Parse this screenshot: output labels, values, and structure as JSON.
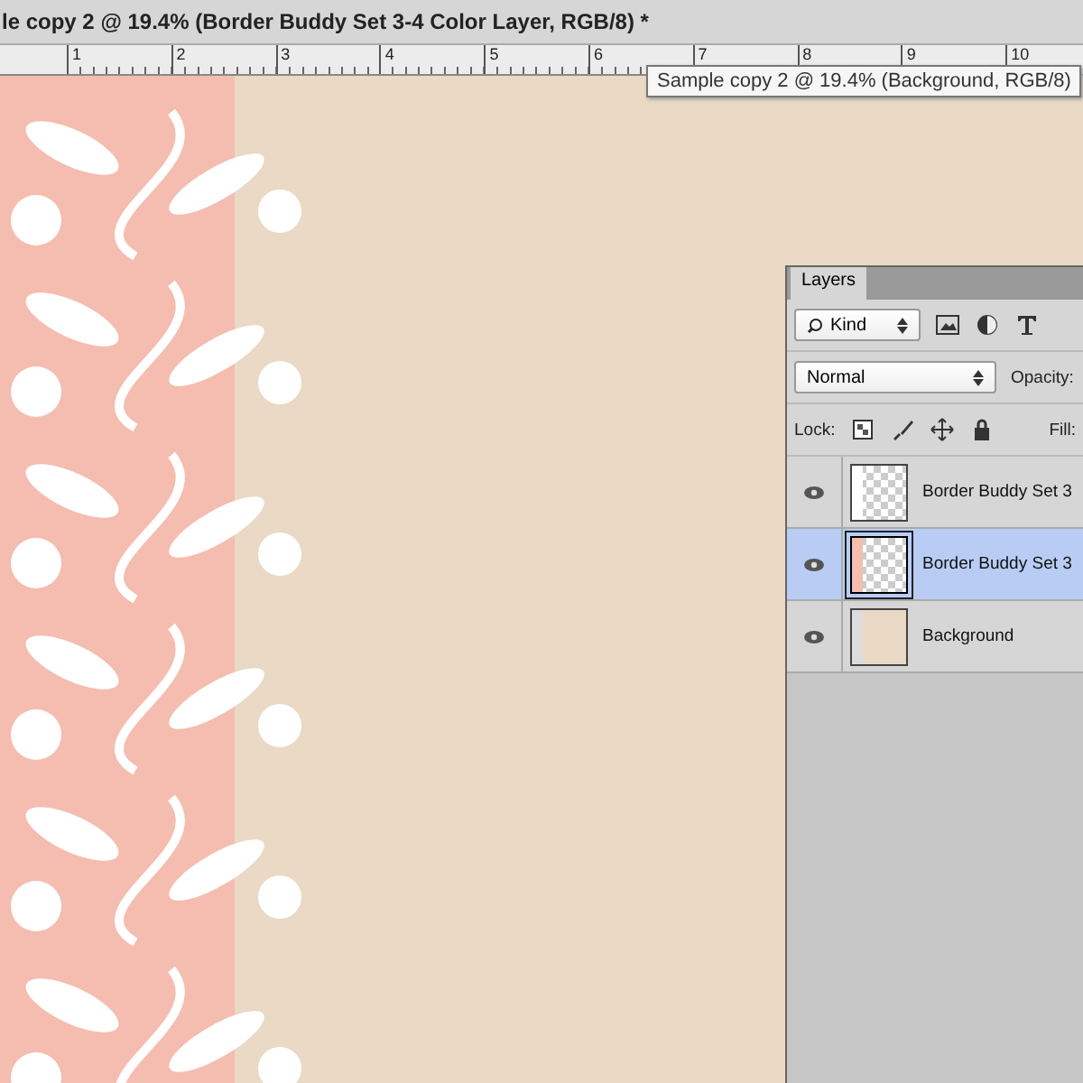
{
  "document_tab": {
    "title": "le copy 2 @ 19.4%  (Border Buddy Set 3-4 Color Layer, RGB/8) *"
  },
  "ruler": {
    "labels": [
      "1",
      "2",
      "3",
      "4",
      "5",
      "6",
      "7",
      "8",
      "9",
      "10"
    ]
  },
  "tooltip": {
    "text": "Sample copy 2 @ 19.4% (Background, RGB/8)"
  },
  "layers_panel": {
    "tab": "Layers",
    "filter": {
      "value": "Kind"
    },
    "blend_mode": {
      "value": "Normal"
    },
    "opacity_label": "Opacity:",
    "lock_label": "Lock:",
    "fill_label": "Fill:",
    "layers": [
      {
        "name": "Border Buddy Set 3",
        "visible": true,
        "selected": false,
        "kind": "pattern"
      },
      {
        "name": "Border Buddy Set 3",
        "visible": true,
        "selected": true,
        "kind": "color"
      },
      {
        "name": "Background",
        "visible": true,
        "selected": false,
        "kind": "background"
      }
    ]
  }
}
